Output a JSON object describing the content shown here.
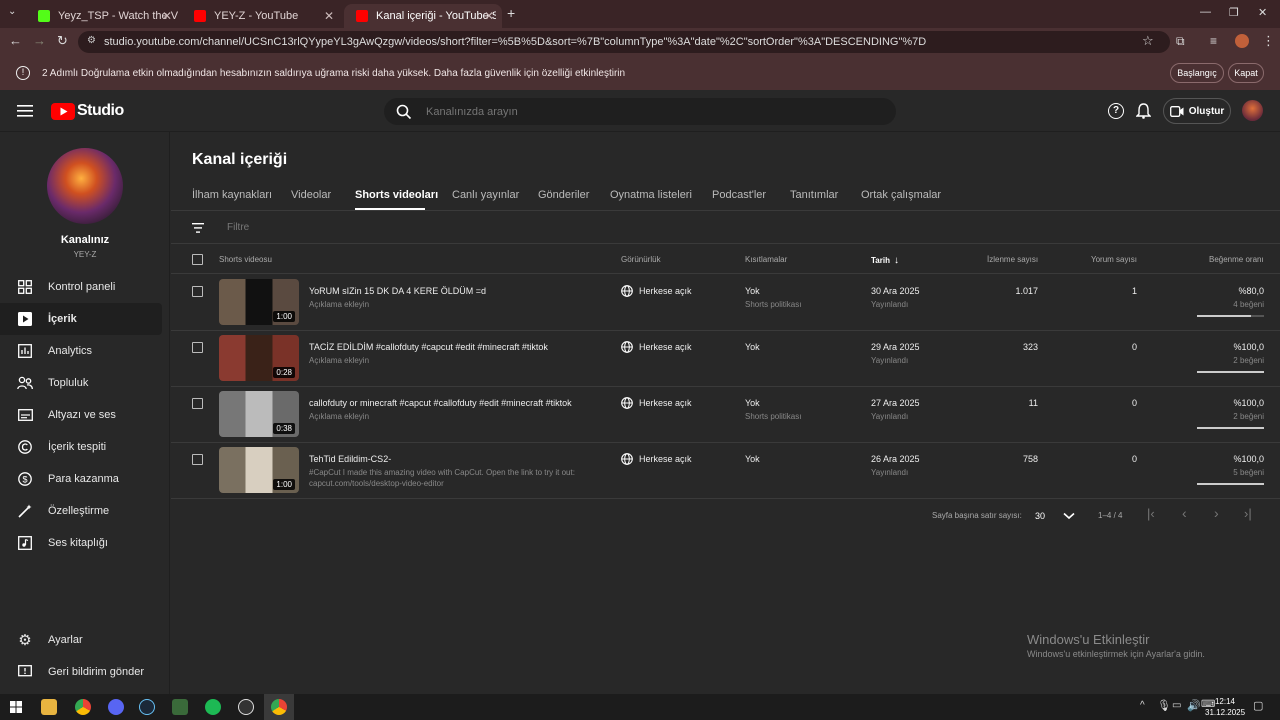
{
  "browser": {
    "tabs": [
      {
        "title": "Yeyz_TSP - Watch the VOD on K",
        "favicon_color": "#53fc18"
      },
      {
        "title": "YEY-Z - YouTube",
        "favicon_color": "#ff0000"
      },
      {
        "title": "Kanal içeriği - YouTube Studio",
        "favicon_color": "#ff0000"
      }
    ],
    "url": "studio.youtube.com/channel/UCSnC13rlQYypeYL3gAwQzgw/videos/short?filter=%5B%5D&sort=%7B\"columnType\"%3A\"date\"%2C\"sortOrder\"%3A\"DESCENDING\"%7D"
  },
  "banner": {
    "message": "2 Adımlı Doğrulama etkin olmadığından hesabınızın saldırıya uğrama riski daha yüksek. Daha fazla güvenlik için özelliği etkinleştirin",
    "start_label": "Başlangıç",
    "close_label": "Kapat"
  },
  "header": {
    "logo_text": "Studio",
    "search_placeholder": "Kanalınızda arayın",
    "create_label": "Oluştur"
  },
  "sidebar": {
    "channel_label": "Kanalınız",
    "channel_name": "YEY-Z",
    "items": [
      {
        "label": "Kontrol paneli",
        "icon": "dashboard-icon"
      },
      {
        "label": "İçerik",
        "icon": "content-icon"
      },
      {
        "label": "Analytics",
        "icon": "analytics-icon"
      },
      {
        "label": "Topluluk",
        "icon": "community-icon"
      },
      {
        "label": "Altyazı ve ses",
        "icon": "subtitles-icon"
      },
      {
        "label": "İçerik tespiti",
        "icon": "copyright-icon"
      },
      {
        "label": "Para kazanma",
        "icon": "monetization-icon"
      },
      {
        "label": "Özelleştirme",
        "icon": "customization-icon"
      },
      {
        "label": "Ses kitaplığı",
        "icon": "audio-library-icon"
      }
    ],
    "bottom": [
      {
        "label": "Ayarlar",
        "icon": "gear-icon"
      },
      {
        "label": "Geri bildirim gönder",
        "icon": "feedback-icon"
      }
    ]
  },
  "main": {
    "title": "Kanal içeriği",
    "tabs": [
      "İlham kaynakları",
      "Videolar",
      "Shorts videoları",
      "Canlı yayınlar",
      "Gönderiler",
      "Oynatma listeleri",
      "Podcast'ler",
      "Tanıtımlar",
      "Ortak çalışmalar"
    ],
    "active_tab": "Shorts videoları",
    "filter_placeholder": "Filtre",
    "columns": {
      "video": "Shorts videosu",
      "visibility": "Görünürlük",
      "restrictions": "Kısıtlamalar",
      "date": "Tarih",
      "views": "İzlenme sayısı",
      "comments": "Yorum sayısı",
      "likes": "Beğenme oranı"
    },
    "rows": [
      {
        "title": "YoRUM sIZin 15 DK DA 4 KERE ÖLDÜM =d",
        "desc": "Açıklama ekleyin",
        "desc2": "",
        "duration": "1:00",
        "visibility": "Herkese açık",
        "restriction": "Yok",
        "restriction2": "Shorts politikası",
        "date": "30 Ara 2025",
        "status": "Yayınlandı",
        "views": "1.017",
        "comments": "1",
        "like_ratio": "%80,0",
        "like_count": "4 beğeni",
        "like_fraction": 0.8
      },
      {
        "title": "TACİZ EDİLDİM #callofduty #capcut #edit #minecraft #tiktok",
        "desc": "Açıklama ekleyin",
        "desc2": "",
        "duration": "0:28",
        "visibility": "Herkese açık",
        "restriction": "Yok",
        "restriction2": "",
        "date": "29 Ara 2025",
        "status": "Yayınlandı",
        "views": "323",
        "comments": "0",
        "like_ratio": "%100,0",
        "like_count": "2 beğeni",
        "like_fraction": 1.0
      },
      {
        "title": "callofduty or minecraft #capcut #callofduty #edit #minecraft #tiktok",
        "desc": "Açıklama ekleyin",
        "desc2": "",
        "duration": "0:38",
        "visibility": "Herkese açık",
        "restriction": "Yok",
        "restriction2": "Shorts politikası",
        "date": "27 Ara 2025",
        "status": "Yayınlandı",
        "views": "11",
        "comments": "0",
        "like_ratio": "%100,0",
        "like_count": "2 beğeni",
        "like_fraction": 1.0
      },
      {
        "title": "TehTid Edildim-CS2-",
        "desc": "#CapCut I made this amazing video with CapCut. Open the link to try it out:",
        "desc2": "capcut.com/tools/desktop-video-editor",
        "duration": "1:00",
        "visibility": "Herkese açık",
        "restriction": "Yok",
        "restriction2": "",
        "date": "26 Ara 2025",
        "status": "Yayınlandı",
        "views": "758",
        "comments": "0",
        "like_ratio": "%100,0",
        "like_count": "5 beğeni",
        "like_fraction": 1.0
      }
    ],
    "pagination": {
      "rows_per_page_label": "Sayfa başına satır sayısı:",
      "rows_per_page": "30",
      "range": "1–4 / 4"
    }
  },
  "watermark": {
    "line1": "Windows'u Etkinleştir",
    "line2": "Windows'u etkinleştirmek için Ayarlar'a gidin."
  },
  "taskbar": {
    "time": "12:14",
    "date": "31.12.2025"
  },
  "colors": {
    "brand_red": "#ff0000",
    "sidebar_active": "#1f1f1f",
    "banner_bg": "#4a3032"
  }
}
